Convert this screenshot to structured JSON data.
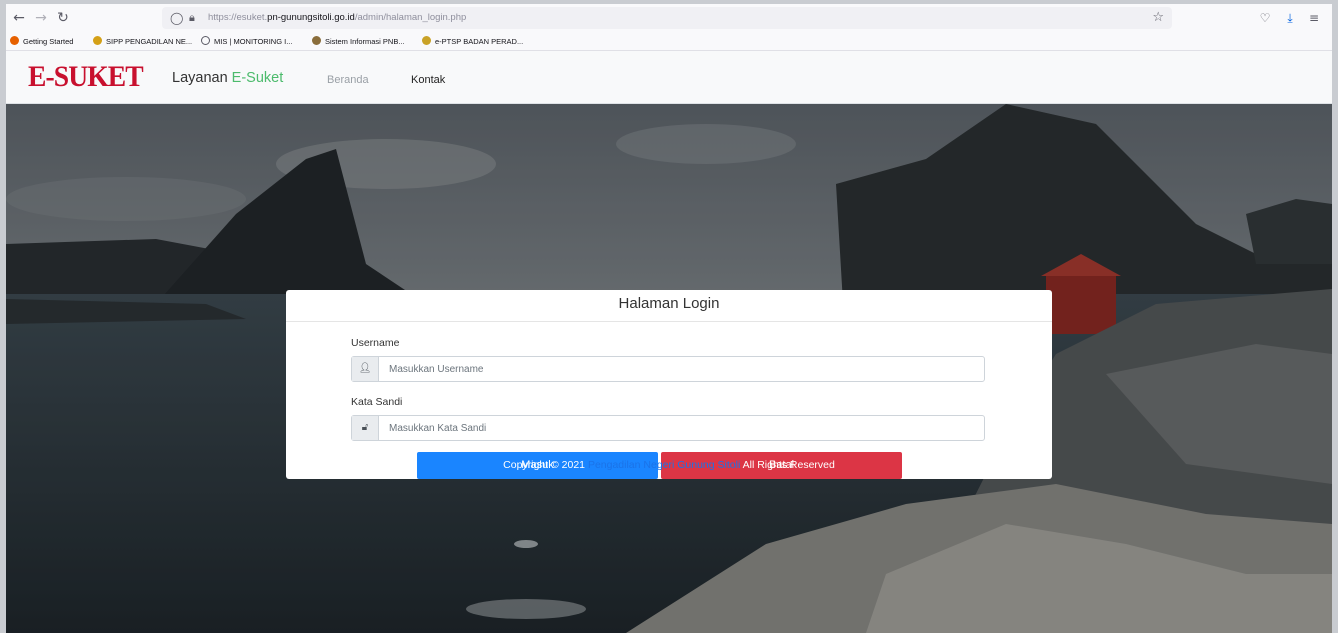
{
  "browser": {
    "url_prefix": "https://esuket.",
    "url_domain": "pn-gunungsitoli.go.id",
    "url_path": "/admin/halaman_login.php",
    "bookmarks": [
      {
        "label": "Getting Started",
        "color": "#e66000"
      },
      {
        "label": "SIPP PENGADILAN NE...",
        "color": "#d4a017"
      },
      {
        "label": "MIS | MONITORING I...",
        "color": "#5b5b66"
      },
      {
        "label": "Sistem Informasi PNB...",
        "color": "#8a6d3b"
      },
      {
        "label": "e-PTSP BADAN PERAD...",
        "color": "#c9a227"
      }
    ]
  },
  "header": {
    "logo": "E-SUKET",
    "brand_prefix": "Layanan ",
    "brand_accent": "E-Suket",
    "nav": [
      "Beranda",
      "Kontak"
    ]
  },
  "login": {
    "title": "Halaman Login",
    "username_label": "Username",
    "username_placeholder": "Masukkan Username",
    "password_label": "Kata Sandi",
    "password_placeholder": "Masukkan Kata Sandi",
    "submit_label": "Masuk",
    "cancel_label": "Batal"
  },
  "footer": {
    "prefix": "Copyright © 2021 ",
    "link": "Pengadilan Negeri Gunung Sitoli",
    "suffix": " All Rights Reserved"
  },
  "colors": {
    "logo": "#c8102e",
    "brand_accent": "#4cbb6c",
    "primary": "#1a85ff",
    "danger": "#dc3545"
  }
}
